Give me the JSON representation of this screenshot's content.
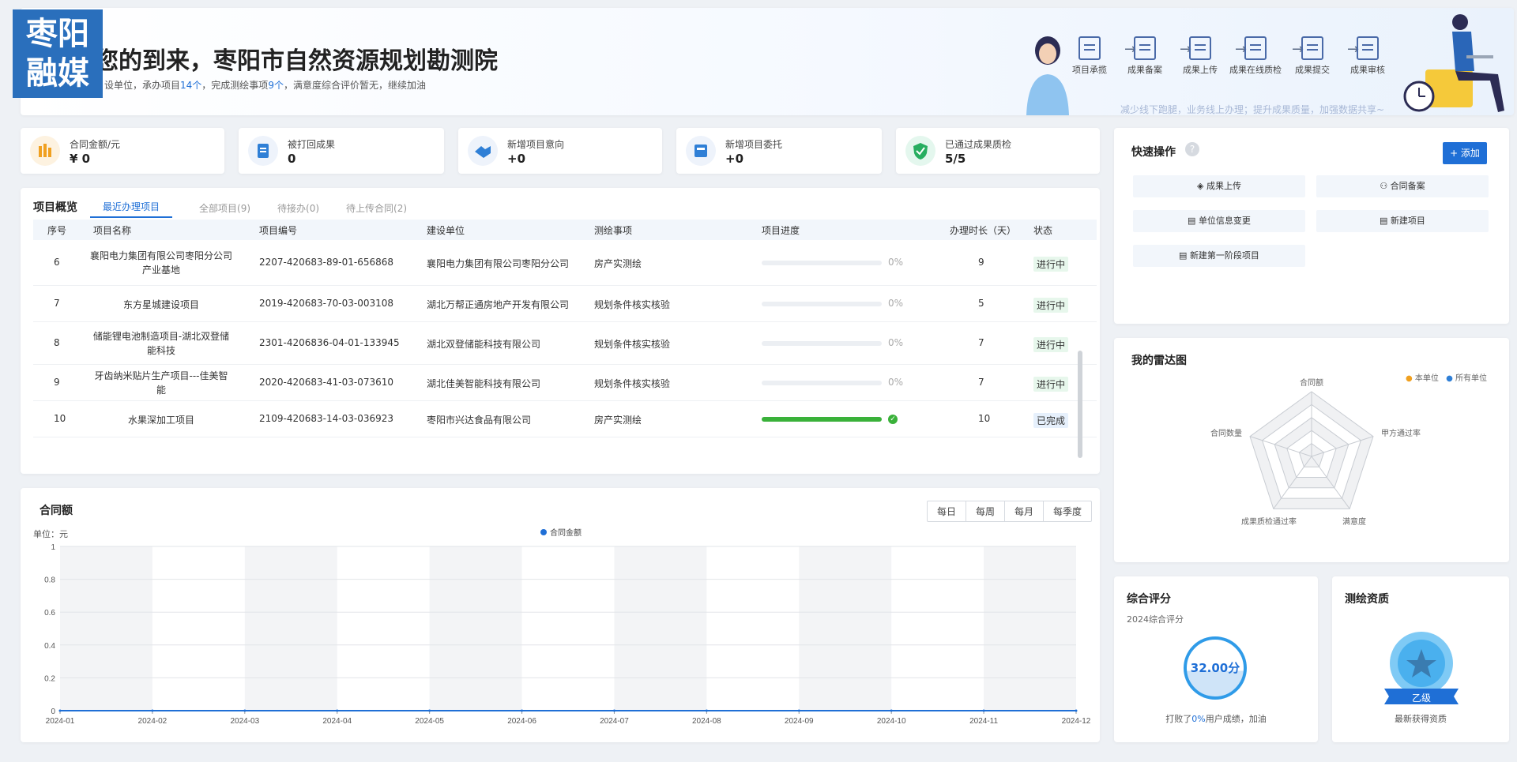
{
  "logo": {
    "line1": "枣阳",
    "line2": "融媒"
  },
  "banner": {
    "title": "您的到来，枣阳市自然资源规划勘测院",
    "sub_a": "设单位，承办项目",
    "sub_projects": "14个",
    "sub_b": "，完成测绘事项",
    "sub_items": "9个",
    "sub_c": "，满意度综合评价暂无，继续加油",
    "slogan": "减少线下跑腿，业务线上办理；提升成果质量，加强数据共享~",
    "flow": [
      "项目承揽",
      "成果备案",
      "成果上传",
      "成果在线质检",
      "成果提交",
      "成果审核"
    ]
  },
  "stats": [
    {
      "label": "合同金额/元",
      "value": "¥ 0"
    },
    {
      "label": "被打回成果",
      "value": "0"
    },
    {
      "label": "新增项目意向",
      "value": "+0"
    },
    {
      "label": "新增项目委托",
      "value": "+0"
    },
    {
      "label": "已通过成果质检",
      "value": "5/5"
    }
  ],
  "projects": {
    "title": "项目概览",
    "tabs": [
      "最近办理项目",
      "全部项目(9)",
      "待接办(0)",
      "待上传合同(2)"
    ],
    "columns": [
      "序号",
      "项目名称",
      "项目编号",
      "建设单位",
      "测绘事项",
      "项目进度",
      "办理时长（天）",
      "状态"
    ],
    "rows": [
      {
        "no": "6",
        "name": "襄阳电力集团有限公司枣阳分公司产业基地",
        "code": "2207-420683-89-01-656868",
        "unit": "襄阳电力集团有限公司枣阳分公司",
        "item": "房产实测绘",
        "progress": "0%",
        "progress_value": 0,
        "days": "9",
        "status": "进行中"
      },
      {
        "no": "7",
        "name": "东方星城建设项目",
        "code": "2019-420683-70-03-003108",
        "unit": "湖北万帮正通房地产开发有限公司",
        "item": "规划条件核实核验",
        "progress": "0%",
        "progress_value": 0,
        "days": "5",
        "status": "进行中"
      },
      {
        "no": "8",
        "name": "储能锂电池制造项目-湖北双登储能科技",
        "code": "2301-4206836-04-01-133945",
        "unit": "湖北双登储能科技有限公司",
        "item": "规划条件核实核验",
        "progress": "0%",
        "progress_value": 0,
        "days": "7",
        "status": "进行中"
      },
      {
        "no": "9",
        "name": "牙齿纳米贴片生产项目---佳美智能",
        "code": "2020-420683-41-03-073610",
        "unit": "湖北佳美智能科技有限公司",
        "item": "规划条件核实核验",
        "progress": "0%",
        "progress_value": 0,
        "days": "7",
        "status": "进行中"
      },
      {
        "no": "10",
        "name": "水果深加工项目",
        "code": "2109-420683-14-03-036923",
        "unit": "枣阳市兴达食品有限公司",
        "item": "房产实测绘",
        "progress": "",
        "progress_value": 100,
        "days": "10",
        "status": "已完成"
      }
    ]
  },
  "contract": {
    "title": "合同额",
    "unit": "单位：元",
    "periods": [
      "每日",
      "每周",
      "每月",
      "每季度"
    ]
  },
  "chart_data": {
    "type": "line",
    "title": "合同额",
    "ylabel": "单位：元",
    "x": [
      "2024-01",
      "2024-02",
      "2024-03",
      "2024-04",
      "2024-05",
      "2024-06",
      "2024-07",
      "2024-08",
      "2024-09",
      "2024-10",
      "2024-11",
      "2024-12"
    ],
    "series": [
      {
        "name": "合同金额",
        "values": [
          0,
          0,
          0,
          0,
          0,
          0,
          0,
          0,
          0,
          0,
          0,
          0
        ]
      }
    ],
    "yticks": [
      "0",
      "0.2",
      "0.4",
      "0.6",
      "0.8",
      "1"
    ],
    "ylim": [
      0,
      1
    ],
    "legend": "top-center",
    "color": "#1f6fd6"
  },
  "quick": {
    "title": "快速操作",
    "add": "+ 添加",
    "buttons": [
      "成果上传",
      "合同备案",
      "单位信息变更",
      "新建项目",
      "新建第一阶段项目"
    ]
  },
  "radar": {
    "title": "我的雷达图",
    "legend": [
      "本单位",
      "所有单位"
    ],
    "legend_colors": [
      "#f0a020",
      "#2f7fd6"
    ],
    "axes": [
      "合同额",
      "甲方通过率",
      "满意度",
      "成果质检通过率",
      "合同数量"
    ]
  },
  "score": {
    "title": "综合评分",
    "sub": "2024综合评分",
    "value": "32.00分",
    "foot_a": "打败了",
    "foot_pct": "0%",
    "foot_b": "用户成绩，加油"
  },
  "qualification": {
    "title": "测绘资质",
    "level": "乙级",
    "foot": "最新获得资质"
  }
}
